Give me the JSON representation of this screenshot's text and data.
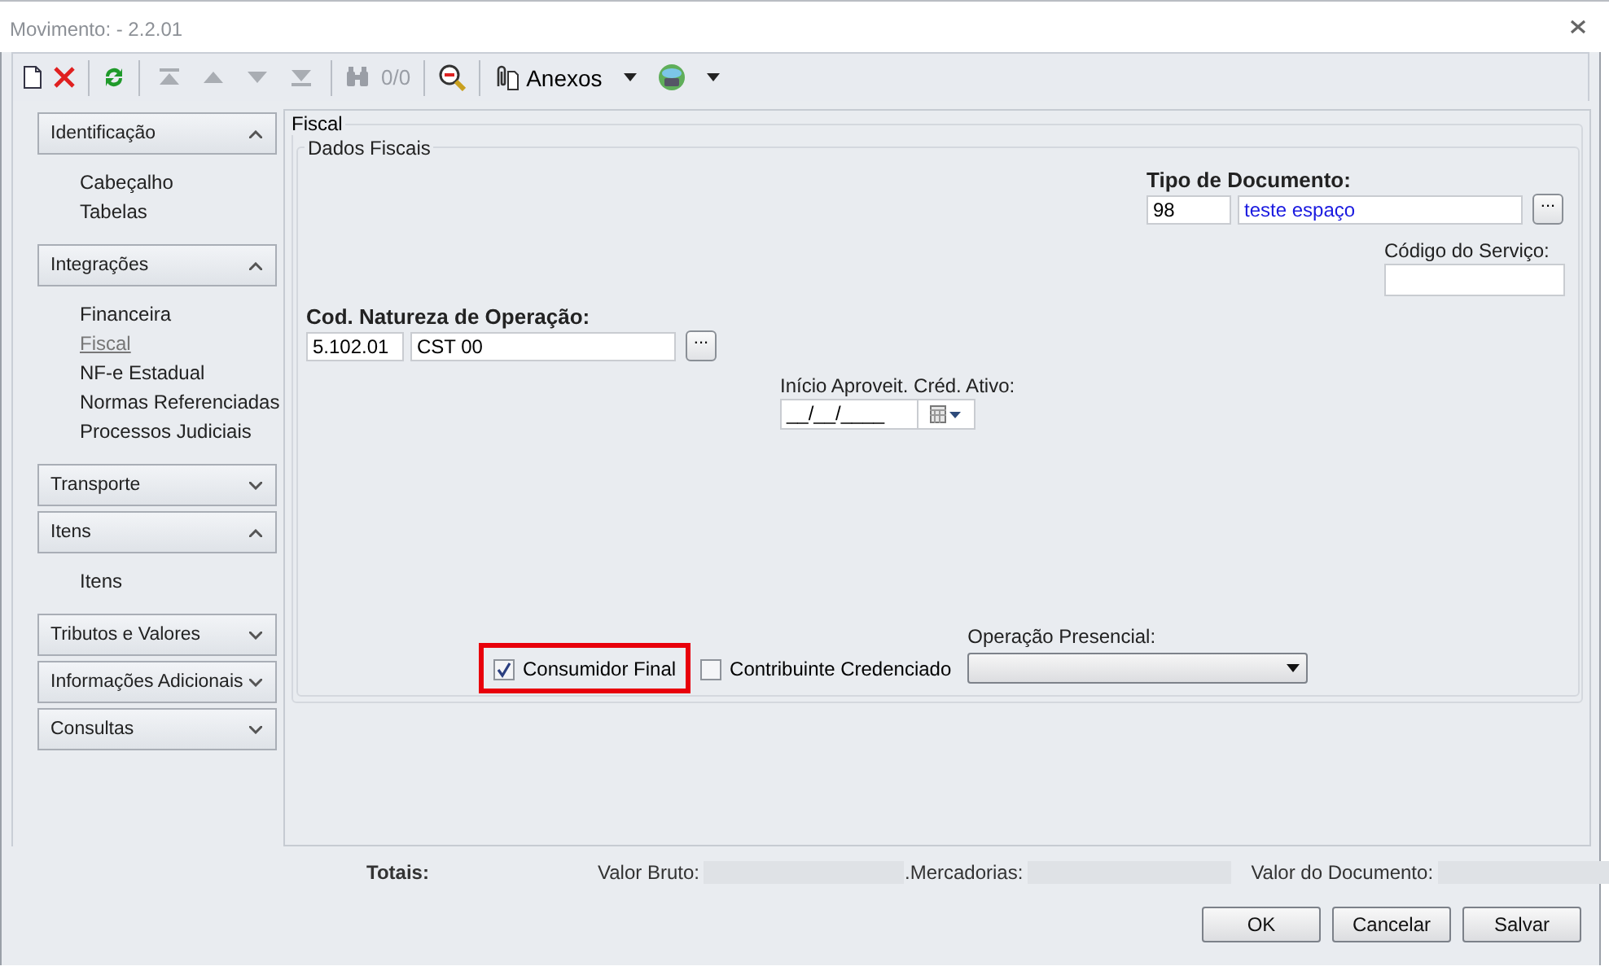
{
  "window": {
    "title": "Movimento:  - 2.2.01"
  },
  "toolbar": {
    "record_nav_disabled": true,
    "counter": "0/0",
    "attachments_label": "Anexos"
  },
  "sidebar": {
    "sections": [
      {
        "label": "Identificação",
        "expanded": true,
        "items": [
          {
            "label": "Cabeçalho",
            "selected": false
          },
          {
            "label": "Tabelas",
            "selected": false
          }
        ]
      },
      {
        "label": "Integrações",
        "expanded": true,
        "items": [
          {
            "label": "Financeira",
            "selected": false
          },
          {
            "label": "Fiscal",
            "selected": true
          },
          {
            "label": "NF-e Estadual",
            "selected": false
          },
          {
            "label": "Normas Referenciadas",
            "selected": false
          },
          {
            "label": "Processos Judiciais",
            "selected": false
          }
        ]
      },
      {
        "label": "Transporte",
        "expanded": false
      },
      {
        "label": "Itens",
        "expanded": true,
        "items": [
          {
            "label": "Itens",
            "selected": false
          }
        ]
      },
      {
        "label": "Tributos e Valores",
        "expanded": false
      },
      {
        "label": "Informações Adicionais",
        "expanded": false
      },
      {
        "label": "Consultas",
        "expanded": false
      }
    ]
  },
  "form": {
    "section": "Fiscal",
    "group": "Dados Fiscais",
    "tipo_documento": {
      "label": "Tipo de Documento:",
      "code": "98",
      "description": "teste espaço",
      "lookup_button": "..."
    },
    "codigo_servico": {
      "label": "Código do Serviço:"
    },
    "natureza": {
      "label": "Cod. Natureza de Operação:",
      "code": "5.102.01",
      "description": "CST 00",
      "lookup_button": "..."
    },
    "inicio_aproveitamento": {
      "label": "Início Aproveit. Créd. Ativo:",
      "value": "__/__/____"
    },
    "checkboxes": [
      {
        "label": "Consumidor Final",
        "checked": true,
        "highlighted": true
      },
      {
        "label": "Contribuinte Credenciado",
        "checked": false,
        "highlighted": false
      }
    ],
    "operacao_presencial": {
      "label": "Operação Presencial:"
    }
  },
  "totals": {
    "title": "Totais:",
    "fields": [
      {
        "label": "Valor Bruto:"
      },
      {
        "label": ".Mercadorias:"
      },
      {
        "label": "Valor do Documento:"
      }
    ]
  },
  "buttons": [
    "OK",
    "Cancelar",
    "Salvar"
  ]
}
